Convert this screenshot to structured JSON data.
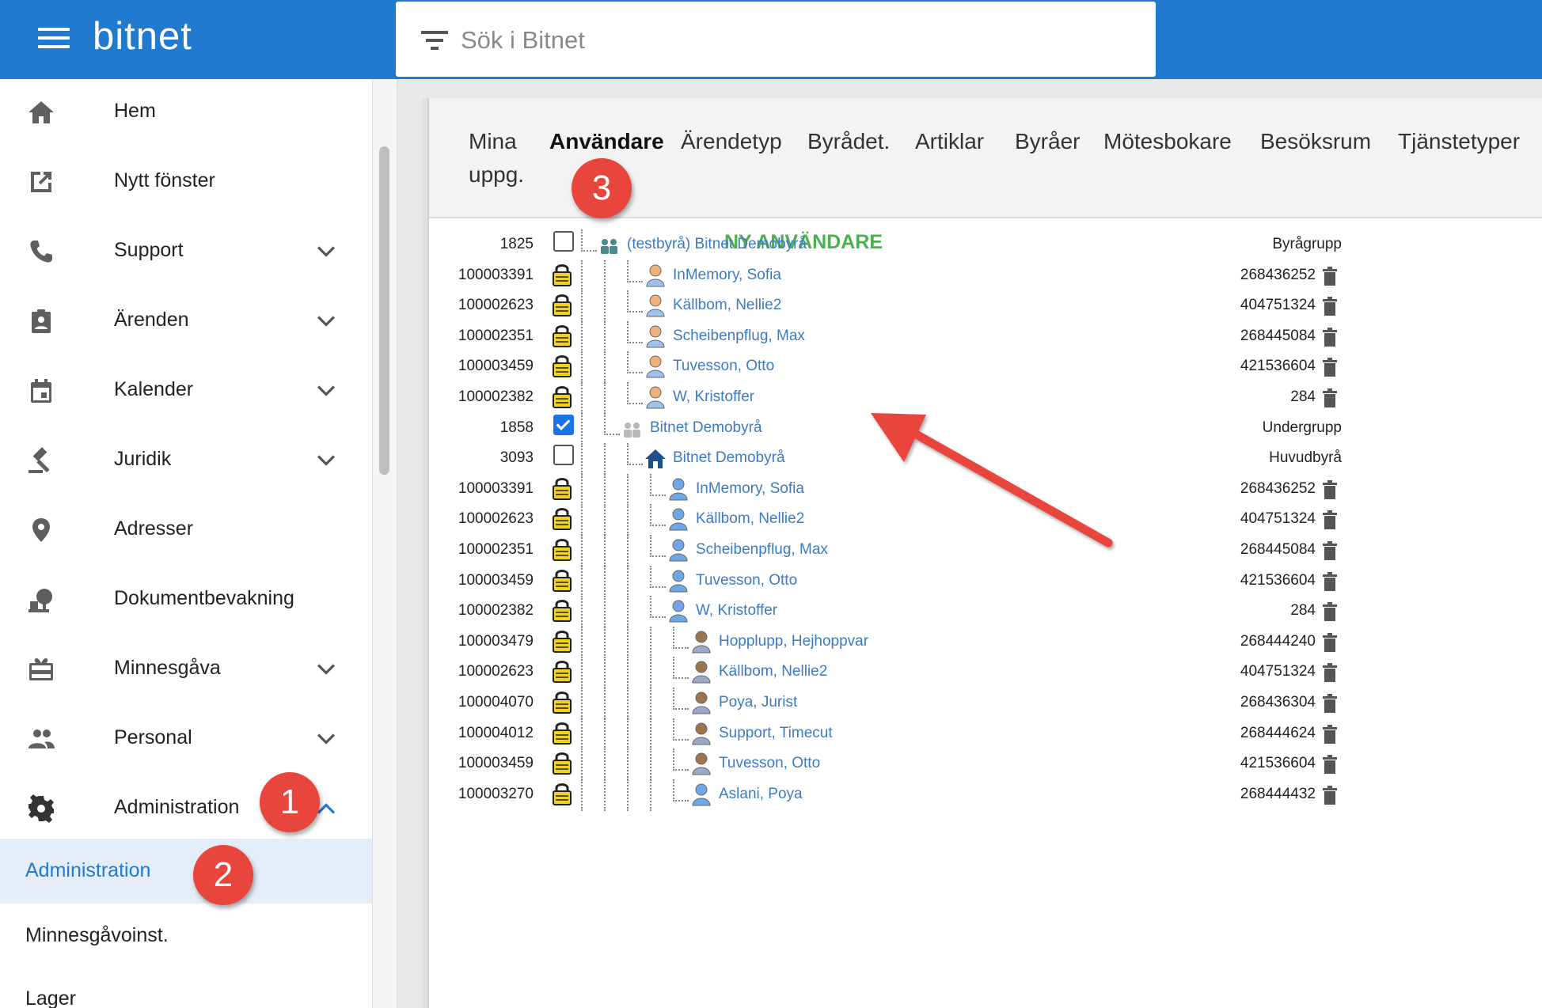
{
  "app": {
    "brand": "bitnet"
  },
  "search": {
    "placeholder": "Sök i Bitnet"
  },
  "sidebar": {
    "items": [
      {
        "label": "Hem",
        "icon": "home-icon",
        "expandable": false
      },
      {
        "label": "Nytt fönster",
        "icon": "open-in-new-icon",
        "expandable": false
      },
      {
        "label": "Support",
        "icon": "phone-icon",
        "expandable": true
      },
      {
        "label": "Ärenden",
        "icon": "clipboard-person-icon",
        "expandable": true
      },
      {
        "label": "Kalender",
        "icon": "calendar-icon",
        "expandable": true
      },
      {
        "label": "Juridik",
        "icon": "gavel-icon",
        "expandable": true
      },
      {
        "label": "Adresser",
        "icon": "location-pin-icon",
        "expandable": false
      },
      {
        "label": "Dokumentbevakning",
        "icon": "document-watch-icon",
        "expandable": false
      },
      {
        "label": "Minnesgåva",
        "icon": "gift-card-icon",
        "expandable": true
      },
      {
        "label": "Personal",
        "icon": "people-icon",
        "expandable": true
      },
      {
        "label": "Administration",
        "icon": "gear-icon",
        "expandable": true,
        "expanded": true
      }
    ],
    "subitems": [
      {
        "label": "Administration",
        "active": true
      },
      {
        "label": "Minnesgåvoinst."
      },
      {
        "label": "Lager"
      }
    ]
  },
  "tabs": [
    {
      "label": "Mina\nuppg."
    },
    {
      "label": "Användare",
      "active": true
    },
    {
      "label": "Ärendetyp"
    },
    {
      "label": "Byrådet."
    },
    {
      "label": "Artiklar"
    },
    {
      "label": "Byråer"
    },
    {
      "label": "Mötesbokare"
    },
    {
      "label": "Besöksrum"
    },
    {
      "label": "Tjänstetyper"
    }
  ],
  "new_user_label": "NY ANVÄNDARE",
  "rows": [
    {
      "id": "1825",
      "control": "checkbox",
      "checked": false,
      "depth": 0,
      "icon": "group",
      "label": "(testbyrå) Bitnet Demobyrå",
      "kind": "Byrågrupp"
    },
    {
      "id": "100003391",
      "control": "lock",
      "depth": 2,
      "icon": "user-orange",
      "label": "InMemory, Sofia",
      "num": "268436252"
    },
    {
      "id": "100002623",
      "control": "lock",
      "depth": 2,
      "icon": "user-orange",
      "label": "Källbom, Nellie2",
      "num": "404751324"
    },
    {
      "id": "100002351",
      "control": "lock",
      "depth": 2,
      "icon": "user-orange",
      "label": "Scheibenpflug, Max",
      "num": "268445084"
    },
    {
      "id": "100003459",
      "control": "lock",
      "depth": 2,
      "icon": "user-orange",
      "label": "Tuvesson, Otto",
      "num": "421536604"
    },
    {
      "id": "100002382",
      "control": "lock",
      "depth": 2,
      "icon": "user-orange",
      "label": "W, Kristoffer",
      "num": "284"
    },
    {
      "id": "1858",
      "control": "checkbox",
      "checked": true,
      "depth": 1,
      "icon": "group-gray",
      "label": "Bitnet Demobyrå",
      "kind": "Undergrupp"
    },
    {
      "id": "3093",
      "control": "checkbox",
      "checked": false,
      "depth": 2,
      "icon": "house",
      "label": "Bitnet Demobyrå",
      "kind": "Huvudbyrå"
    },
    {
      "id": "100003391",
      "control": "lock",
      "depth": 3,
      "icon": "user-blue",
      "label": "InMemory, Sofia",
      "num": "268436252"
    },
    {
      "id": "100002623",
      "control": "lock",
      "depth": 3,
      "icon": "user-blue",
      "label": "Källbom, Nellie2",
      "num": "404751324"
    },
    {
      "id": "100002351",
      "control": "lock",
      "depth": 3,
      "icon": "user-blue",
      "label": "Scheibenpflug, Max",
      "num": "268445084"
    },
    {
      "id": "100003459",
      "control": "lock",
      "depth": 3,
      "icon": "user-blue",
      "label": "Tuvesson, Otto",
      "num": "421536604"
    },
    {
      "id": "100002382",
      "control": "lock",
      "depth": 3,
      "icon": "user-blue",
      "label": "W, Kristoffer",
      "num": "284"
    },
    {
      "id": "100003479",
      "control": "lock",
      "depth": 4,
      "icon": "user-brown",
      "label": "Hopplupp, Hejhoppvar",
      "num": "268444240"
    },
    {
      "id": "100002623",
      "control": "lock",
      "depth": 4,
      "icon": "user-brown",
      "label": "Källbom, Nellie2",
      "num": "404751324"
    },
    {
      "id": "100004070",
      "control": "lock",
      "depth": 4,
      "icon": "user-brown",
      "label": "Poya, Jurist",
      "num": "268436304"
    },
    {
      "id": "100004012",
      "control": "lock",
      "depth": 4,
      "icon": "user-brown",
      "label": "Support, Timecut",
      "num": "268444624"
    },
    {
      "id": "100003459",
      "control": "lock",
      "depth": 4,
      "icon": "user-brown",
      "label": "Tuvesson, Otto",
      "num": "421536604"
    },
    {
      "id": "100003270",
      "control": "lock",
      "depth": 4,
      "icon": "user-blue",
      "label": "Aslani, Poya",
      "num": "268444432"
    }
  ],
  "annotations": [
    {
      "label": "1"
    },
    {
      "label": "2"
    },
    {
      "label": "3"
    }
  ],
  "colors": {
    "brand": "#1f7ad0",
    "link": "#3b7bc4",
    "new_user": "#4caf50",
    "badge": "#e8453c"
  }
}
